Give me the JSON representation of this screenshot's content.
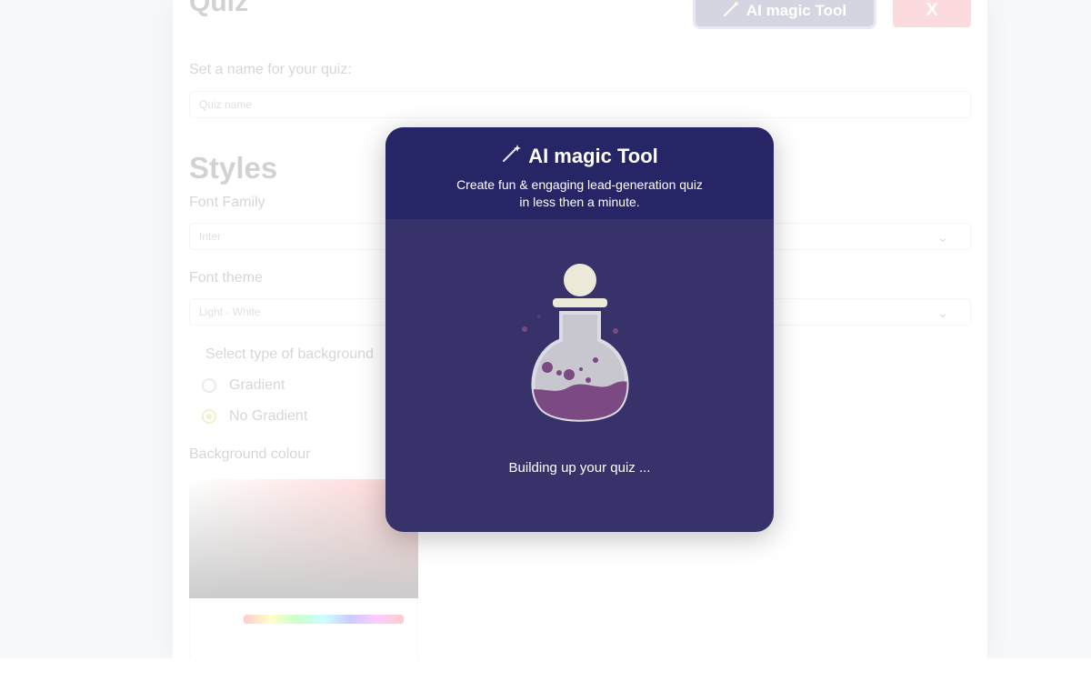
{
  "background_form": {
    "title": "Quiz",
    "ai_button_label": "AI magic Tool",
    "close_label": "X",
    "quiz_name_label": "Set a name for your quiz:",
    "quiz_name_placeholder": "Quiz name",
    "styles_heading": "Styles",
    "font_family_label": "Font Family",
    "font_family_value": "Inter",
    "font_theme_label": "Font theme",
    "font_theme_value": "Light - White",
    "background_type_label": "Select type of background",
    "background_options": [
      "Gradient",
      "No Gradient"
    ],
    "background_selected": "No Gradient",
    "background_colour_label": "Background colour"
  },
  "modal": {
    "title": "AI magic Tool",
    "subtitle_line1": "Create fun & engaging lead-generation quiz",
    "subtitle_line2": "in less then a minute.",
    "status": "Building up your quiz ...",
    "icon": "magic-wand-icon",
    "illustration": "potion-flask"
  },
  "colors": {
    "modal_header": "#262566",
    "modal_body": "#37336a",
    "potion_liquid": "#7b4a83",
    "close_button": "#ef4a5a"
  }
}
